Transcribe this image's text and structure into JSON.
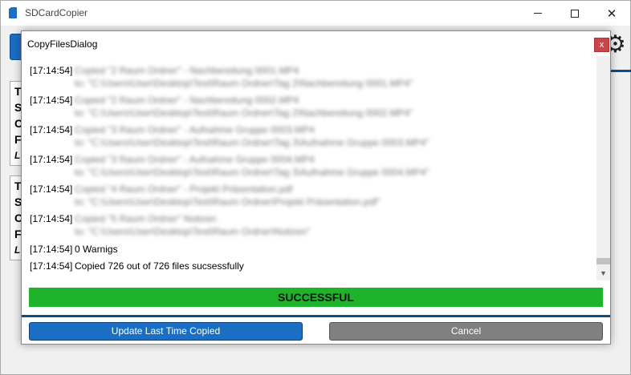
{
  "window": {
    "title": "SDCardCopier",
    "icon": "sd-card-icon"
  },
  "background": {
    "card1_lines": [
      "T",
      "S",
      "C",
      "F",
      "L"
    ],
    "card2_lines": [
      "T",
      "S",
      "C",
      "F",
      "L"
    ]
  },
  "dialog": {
    "title": "CopyFilesDialog",
    "close_label": "x",
    "log": [
      {
        "time": "[17:14:54]",
        "message": "Copied \"2 Raum Ordner\" - Nachbereitung 0001.MP4",
        "detail": "to: \"C:\\Users\\User\\Desktop\\Test\\Raum Ordner\\Tag 2\\Nachbereitung 0001.MP4\""
      },
      {
        "time": "[17:14:54]",
        "message": "Copied \"2 Raum Ordner\" - Nachbereitung 0002.MP4",
        "detail": "to: \"C:\\Users\\User\\Desktop\\Test\\Raum Ordner\\Tag 2\\Nachbereitung 0002.MP4\""
      },
      {
        "time": "[17:14:54]",
        "message": "Copied \"3 Raum Ordner\" - Aufnahme Gruppe 0003.MP4",
        "detail": "to: \"C:\\Users\\User\\Desktop\\Test\\Raum Ordner\\Tag 3\\Aufnahme Gruppe 0003.MP4\""
      },
      {
        "time": "[17:14:54]",
        "message": "Copied \"3 Raum Ordner\" - Aufnahme Gruppe 0004.MP4",
        "detail": "to: \"C:\\Users\\User\\Desktop\\Test\\Raum Ordner\\Tag 3\\Aufnahme Gruppe 0004.MP4\""
      },
      {
        "time": "[17:14:54]",
        "message": "Copied \"4 Raum Ordner\" - Projekt Präsentation.pdf",
        "detail": "to: \"C:\\Users\\User\\Desktop\\Test\\Raum Ordner\\Projekt Präsentation.pdf\""
      },
      {
        "time": "[17:14:54]",
        "message": "Copied \"5 Raum Ordner\" Notizen",
        "detail": "to: \"C:\\Users\\User\\Desktop\\Test\\Raum Ordner\\Notizen\""
      },
      {
        "time": "[17:14:54]",
        "message": "0 Warnigs",
        "detail": ""
      },
      {
        "time": "[17:14:54]",
        "message": "Copied 726 out of 726 files sucsessfully",
        "detail": ""
      }
    ],
    "status": "SUCCESSFUL",
    "status_color": "#1fb32c",
    "update_button": "Update Last Time Copied",
    "cancel_button": "Cancel"
  },
  "colors": {
    "accent": "#1a6fc4",
    "separator": "#0b4e8c",
    "close": "#c9444b",
    "cancel": "#808080"
  }
}
